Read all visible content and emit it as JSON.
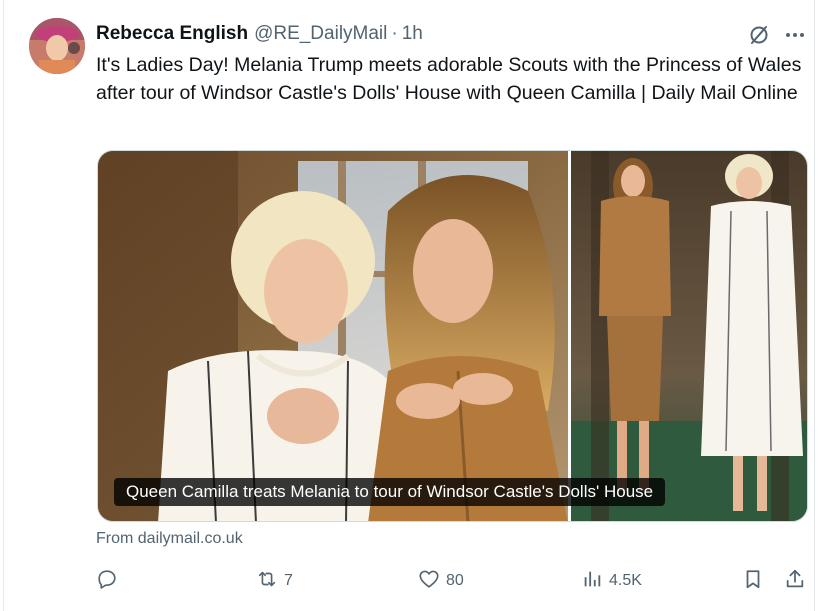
{
  "tweet": {
    "author_name": "Rebecca English",
    "handle": "@RE_DailyMail",
    "separator": "·",
    "time": "1h",
    "text": "It's Ladies Day! Melania Trump meets adorable Scouts with the Princess of Wales after tour of Windsor Castle's Dolls' House with Queen Camilla | Daily Mail Online"
  },
  "card": {
    "caption": "Queen Camilla treats Melania to tour of Windsor Castle's Dolls' House",
    "source": "From dailymail.co.uk"
  },
  "actions": {
    "reply_icon": "reply-icon",
    "retweet_icon": "retweet-icon",
    "retweet_count": "7",
    "like_icon": "heart-icon",
    "like_count": "80",
    "views_icon": "views-chart-icon",
    "views_count": "4.5K",
    "bookmark_icon": "bookmark-icon",
    "share_icon": "share-icon"
  },
  "header_icons": {
    "grok": "grok-slash-icon",
    "more": "more-icon"
  },
  "colors": {
    "text_primary": "#0f1419",
    "text_secondary": "#536471",
    "border": "#cfd9de",
    "caption_bg": "#000000"
  }
}
